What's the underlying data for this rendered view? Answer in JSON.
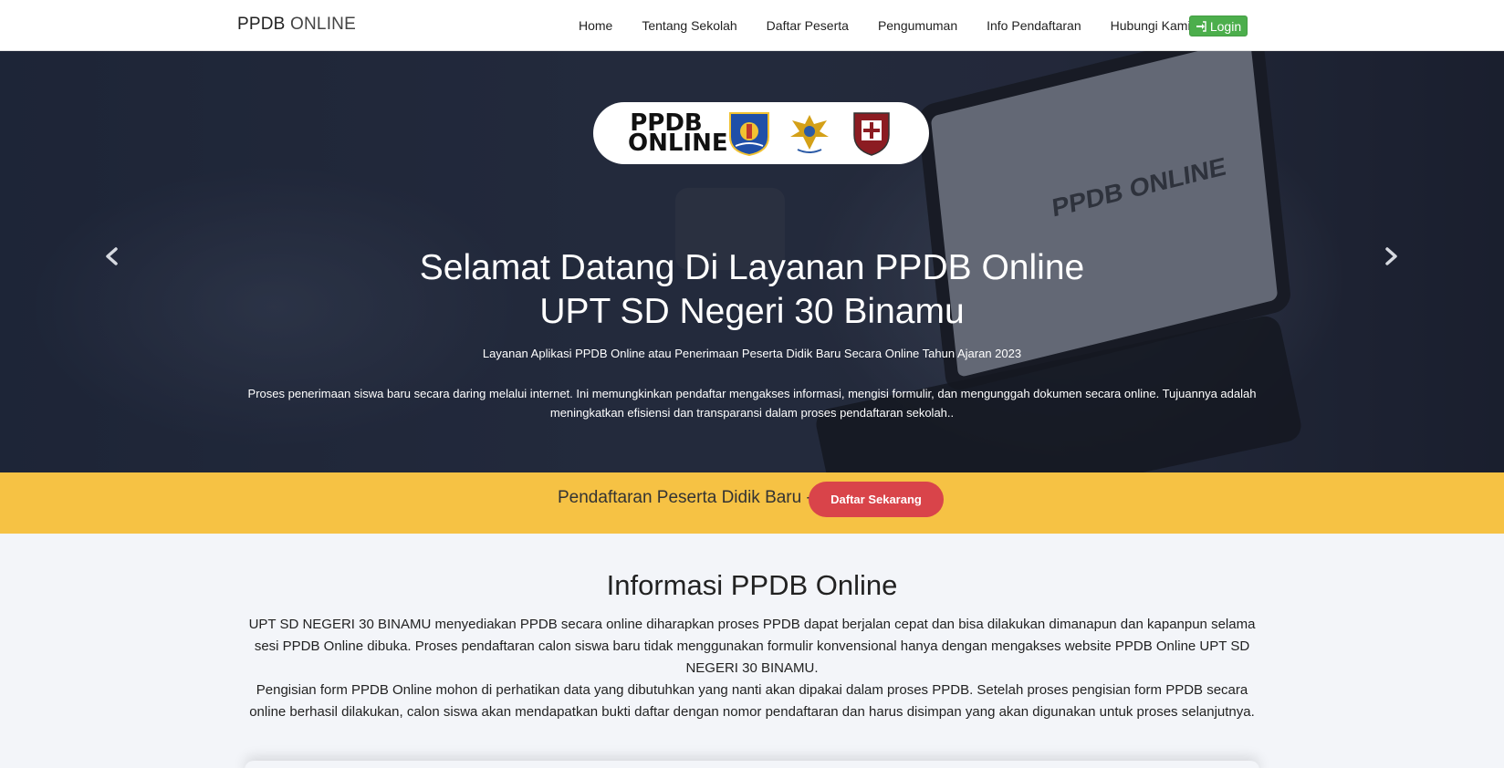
{
  "navbar": {
    "brand_strong": "PPDB",
    "brand_light": "ONLINE",
    "items": [
      {
        "label": "Home"
      },
      {
        "label": "Tentang Sekolah"
      },
      {
        "label": "Daftar Peserta"
      },
      {
        "label": "Pengumuman"
      },
      {
        "label": "Info Pendaftaran"
      },
      {
        "label": "Hubungi Kami"
      }
    ],
    "login_label": "Login",
    "login_icon": "sign-in-icon",
    "login_color": "#4cae4c"
  },
  "hero": {
    "logo_text_line1": "PPDB",
    "logo_text_line2": "ONLINE",
    "title_line1": "Selamat Datang Di Layanan PPDB Online",
    "title_line2": "UPT SD Negeri 30 Binamu",
    "subtitle": "Layanan Aplikasi PPDB Online atau Penerimaan Peserta Didik Baru Secara Online Tahun Ajaran 2023",
    "description": "Proses penerimaan siswa baru secara daring melalui internet. Ini memungkinkan pendaftar mengakses informasi, mengisi formulir, dan mengunggah dokumen secara online. Tujuannya adalah meningkatkan efisiensi dan transparansi dalam proses pendaftaran sekolah..",
    "screen_text": "PPDB ONLINE",
    "prev_icon": "chevron-left-icon",
    "next_icon": "chevron-right-icon"
  },
  "banner": {
    "text": "Pendaftaran Peserta Didik Baru -",
    "button_label": "Daftar Sekarang",
    "background": "#f6c244",
    "button_color": "#d9444a"
  },
  "info": {
    "title": "Informasi PPDB Online",
    "paragraph1": "UPT SD NEGERI 30 BINAMU menyediakan PPDB secara online diharapkan proses PPDB dapat berjalan cepat dan bisa dilakukan dimanapun dan kapanpun selama sesi PPDB Online dibuka. Proses pendaftaran calon siswa baru tidak menggunakan formulir konvensional hanya dengan mengakses website PPDB Online UPT SD NEGERI 30 BINAMU.",
    "paragraph2": "Pengisian form PPDB Online mohon di perhatikan data yang dibutuhkan yang nanti akan dipakai dalam proses PPDB. Setelah proses pengisian form PPDB secara online berhasil dilakukan, calon siswa akan mendapatkan bukti daftar dengan nomor pendaftaran dan harus disimpan yang akan digunakan untuk proses selanjutnya."
  }
}
